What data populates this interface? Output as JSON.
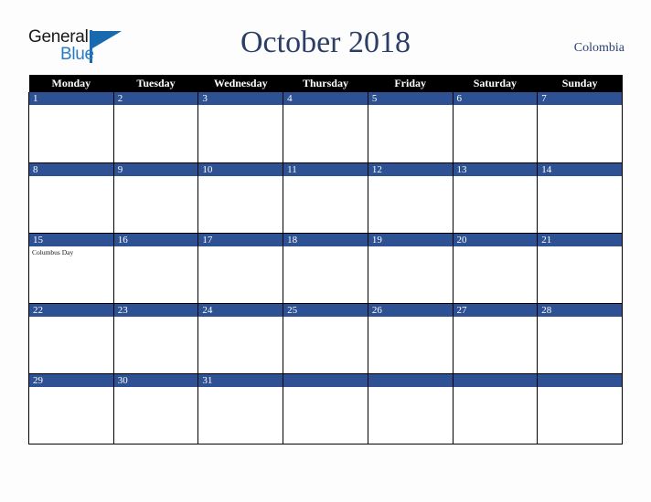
{
  "logo": {
    "name": "General Blue",
    "word_top": "General",
    "word_bottom": "Blue",
    "color_dark": "#1a1a1a",
    "color_blue": "#2b7bc4",
    "triangle_color": "#1769b0"
  },
  "header": {
    "title": "October 2018",
    "title_color": "#2b3f66",
    "country": "Colombia",
    "country_color": "#2b4273"
  },
  "calendar": {
    "month": "October",
    "year": "2018",
    "accent_color": "#2d5193",
    "header_background": "#000000",
    "weekdays": [
      "Monday",
      "Tuesday",
      "Wednesday",
      "Thursday",
      "Friday",
      "Saturday",
      "Sunday"
    ],
    "weeks": [
      [
        {
          "day": "1",
          "events": []
        },
        {
          "day": "2",
          "events": []
        },
        {
          "day": "3",
          "events": []
        },
        {
          "day": "4",
          "events": []
        },
        {
          "day": "5",
          "events": []
        },
        {
          "day": "6",
          "events": []
        },
        {
          "day": "7",
          "events": []
        }
      ],
      [
        {
          "day": "8",
          "events": []
        },
        {
          "day": "9",
          "events": []
        },
        {
          "day": "10",
          "events": []
        },
        {
          "day": "11",
          "events": []
        },
        {
          "day": "12",
          "events": []
        },
        {
          "day": "13",
          "events": []
        },
        {
          "day": "14",
          "events": []
        }
      ],
      [
        {
          "day": "15",
          "events": [
            "Columbus Day"
          ]
        },
        {
          "day": "16",
          "events": []
        },
        {
          "day": "17",
          "events": []
        },
        {
          "day": "18",
          "events": []
        },
        {
          "day": "19",
          "events": []
        },
        {
          "day": "20",
          "events": []
        },
        {
          "day": "21",
          "events": []
        }
      ],
      [
        {
          "day": "22",
          "events": []
        },
        {
          "day": "23",
          "events": []
        },
        {
          "day": "24",
          "events": []
        },
        {
          "day": "25",
          "events": []
        },
        {
          "day": "26",
          "events": []
        },
        {
          "day": "27",
          "events": []
        },
        {
          "day": "28",
          "events": []
        }
      ],
      [
        {
          "day": "29",
          "events": []
        },
        {
          "day": "30",
          "events": []
        },
        {
          "day": "31",
          "events": []
        },
        {
          "day": "",
          "events": []
        },
        {
          "day": "",
          "events": []
        },
        {
          "day": "",
          "events": []
        },
        {
          "day": "",
          "events": []
        }
      ]
    ]
  }
}
